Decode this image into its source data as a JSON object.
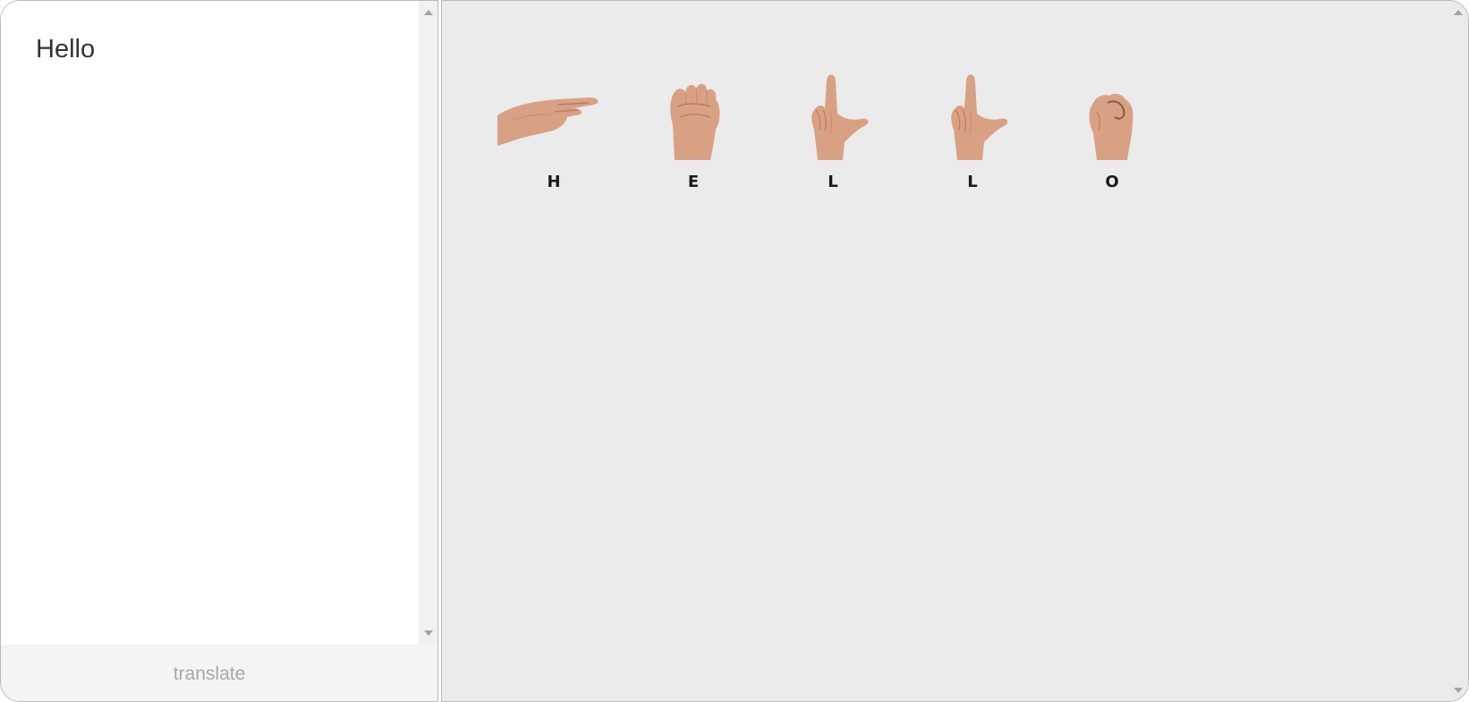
{
  "input": {
    "text": "Hello"
  },
  "actions": {
    "translate_label": "translate"
  },
  "output": {
    "signs": [
      {
        "letter": "H",
        "icon": "asl-h-hand-icon"
      },
      {
        "letter": "E",
        "icon": "asl-e-hand-icon"
      },
      {
        "letter": "L",
        "icon": "asl-l-hand-icon"
      },
      {
        "letter": "L",
        "icon": "asl-l-hand-icon"
      },
      {
        "letter": "O",
        "icon": "asl-o-hand-icon"
      }
    ]
  },
  "colors": {
    "skin": "#d9a184",
    "skin_shadow": "#b97a5e",
    "panel_bg": "#ebebeb",
    "button_bg": "#f4f4f4",
    "button_text": "#a8a8a8"
  }
}
